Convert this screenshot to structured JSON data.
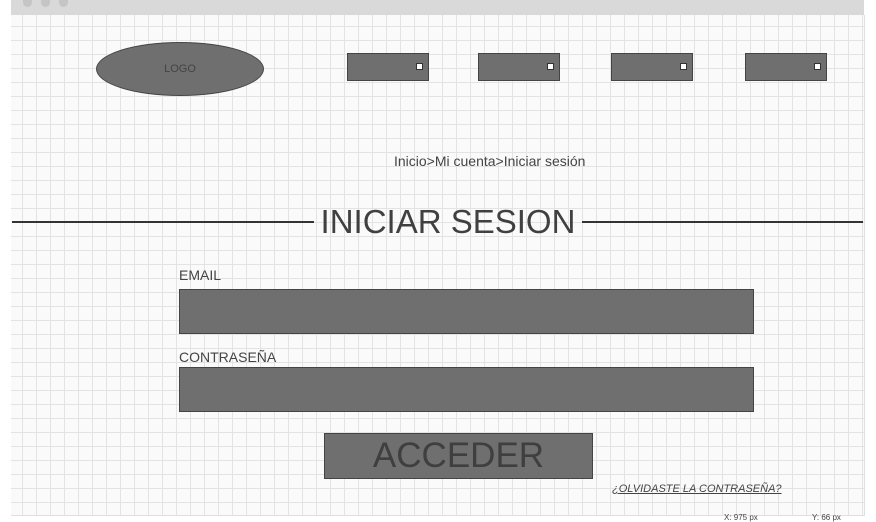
{
  "header": {
    "logo_text": "LOGO",
    "nav_items": [
      "",
      "",
      "",
      ""
    ]
  },
  "breadcrumb": "Inicio>Mi cuenta>Iniciar sesión",
  "page_title": "INICIAR SESION",
  "form": {
    "email_label": "EMAIL",
    "email_value": "",
    "password_label": "CONTRASEÑA",
    "password_value": "",
    "submit_label": "ACCEDER",
    "forgot_link": "¿OLVIDASTE LA CONTRASEÑA?"
  },
  "status_bar": {
    "x_readout": "X: 975 px",
    "y_readout": "Y: 66 px"
  },
  "colors": {
    "placeholder_fill": "#6f6f6f",
    "outline": "#444444",
    "grid_line": "#e3e3e3",
    "titlebar": "#d9d9d9"
  }
}
